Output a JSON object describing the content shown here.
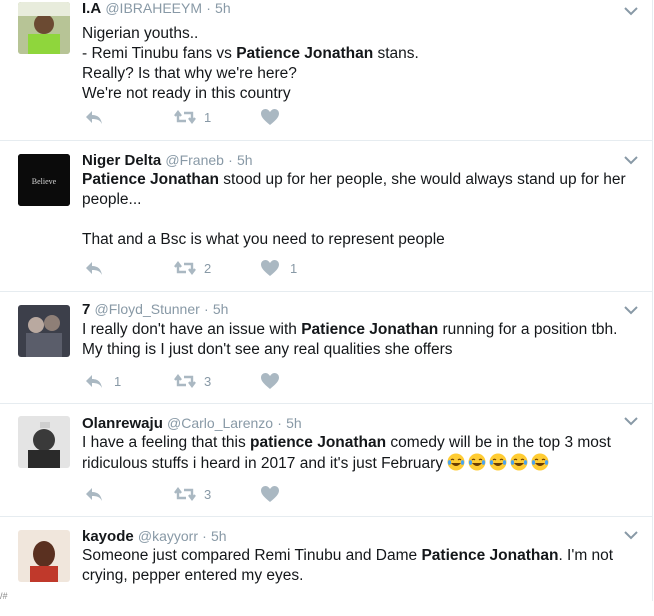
{
  "tweets": [
    {
      "name": "I.A",
      "handle": "@IBRAHEEYM",
      "time": "5h",
      "lines": [
        [
          {
            "t": "Nigerian youths.."
          }
        ],
        [
          {
            "t": "- Remi Tinubu fans vs "
          },
          {
            "t": "Patience Jonathan",
            "b": true
          },
          {
            "t": " stans."
          }
        ],
        [
          {
            "t": "Really? Is that why we're here?"
          }
        ],
        [
          {
            "t": "We're not ready in this country"
          }
        ]
      ],
      "retweets": "1",
      "likes": "",
      "replies": ""
    },
    {
      "name": "Niger Delta",
      "handle": "@Franeb",
      "time": "5h",
      "avatar_text": "Believe",
      "lines": [
        [
          {
            "t": "Patience Jonathan",
            "b": true
          },
          {
            "t": " stood up for her people, she would always stand up for her"
          }
        ],
        [
          {
            "t": "people..."
          }
        ],
        [
          {
            "t": ""
          }
        ],
        [
          {
            "t": "That and a Bsc is what you need to represent people"
          }
        ]
      ],
      "retweets": "2",
      "likes": "1",
      "replies": ""
    },
    {
      "name": "7",
      "handle": "@Floyd_Stunner",
      "time": "5h",
      "lines": [
        [
          {
            "t": "I really don't have an issue with "
          },
          {
            "t": "Patience Jonathan",
            "b": true
          },
          {
            "t": " running for a position tbh."
          }
        ],
        [
          {
            "t": "My thing is I just don't see any real qualities she offers"
          }
        ]
      ],
      "retweets": "3",
      "likes": "",
      "replies": "1"
    },
    {
      "name": "Olanrewaju",
      "handle": "@Carlo_Larenzo",
      "time": "5h",
      "lines": [
        [
          {
            "t": "I have a feeling that this "
          },
          {
            "t": "patience Jonathan",
            "b": true
          },
          {
            "t": " comedy will be in the top 3 most"
          }
        ],
        [
          {
            "t": "ridiculous stuffs i heard in 2017 and it's just February "
          }
        ]
      ],
      "emoji_count": 5,
      "retweets": "3",
      "likes": "",
      "replies": ""
    },
    {
      "name": "kayode",
      "handle": "@kayyorr",
      "time": "5h",
      "lines": [
        [
          {
            "t": "Someone just compared Remi Tinubu and Dame "
          },
          {
            "t": "Patience Jonathan",
            "b": true
          },
          {
            "t": ". I'm not"
          }
        ],
        [
          {
            "t": "crying, pepper entered my eyes."
          }
        ]
      ],
      "retweets": "",
      "likes": "",
      "replies": ""
    }
  ],
  "separator": "·",
  "colors": {
    "text": "#14171a",
    "muted": "#8899a6",
    "border": "#e6ecf0",
    "icon": "#aab8c2"
  },
  "corner_mark": "/#"
}
